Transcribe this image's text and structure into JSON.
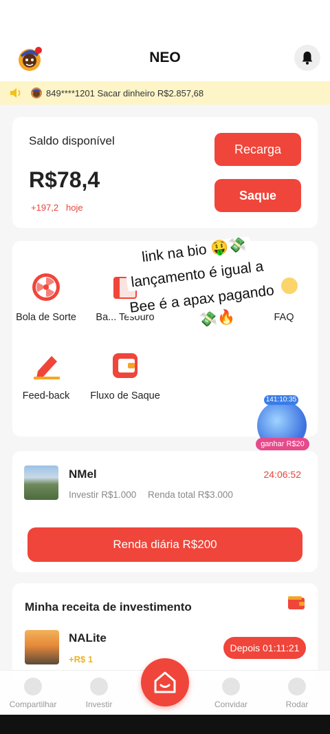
{
  "app": {
    "title": "NEO"
  },
  "ticker": {
    "text": "849****1201 Sacar dinheiro R$2.857,68"
  },
  "balance": {
    "label": "Saldo disponível",
    "value": "R$78,4",
    "change": "+197,2",
    "change_suffix": "hoje",
    "recarga_label": "Recarga",
    "saque_label": "Saque"
  },
  "features": [
    {
      "label": "Bola de Sorte",
      "icon": "lucky-wheel-icon"
    },
    {
      "label": "Ba... Tesouro",
      "icon": "treasure-box-icon"
    },
    {
      "label": "FAQ",
      "icon": "faq-icon"
    },
    {
      "label": "Feed-back",
      "icon": "pencil-icon"
    },
    {
      "label": "Fluxo de Saque",
      "icon": "wallet-icon"
    }
  ],
  "overlay": {
    "line1": "link na bio 🤑💸",
    "line2": "lançamento é igual a",
    "line3": "Bee é a apax pagando",
    "line4": "💸🔥"
  },
  "float_badge": {
    "timer": "141:10:35",
    "label": "ganhar R$20"
  },
  "product": {
    "name": "NMel",
    "timer": "24:06:52",
    "invest": "Investir R$1.000",
    "total": "Renda total R$3.000",
    "button": "Renda diária R$200"
  },
  "receita": {
    "title": "Minha receita de investimento",
    "item_name": "NALite",
    "item_gain": "+R$ 1",
    "button": "Depois 01:11:21"
  },
  "nav": {
    "compartilhar": "Compartilhar",
    "investir": "Investir",
    "convidar": "Convidar",
    "rodar": "Rodar"
  },
  "colors": {
    "accent": "#f0453a",
    "ticker_bg": "#fdf5c8",
    "gold": "#e8b52a"
  }
}
